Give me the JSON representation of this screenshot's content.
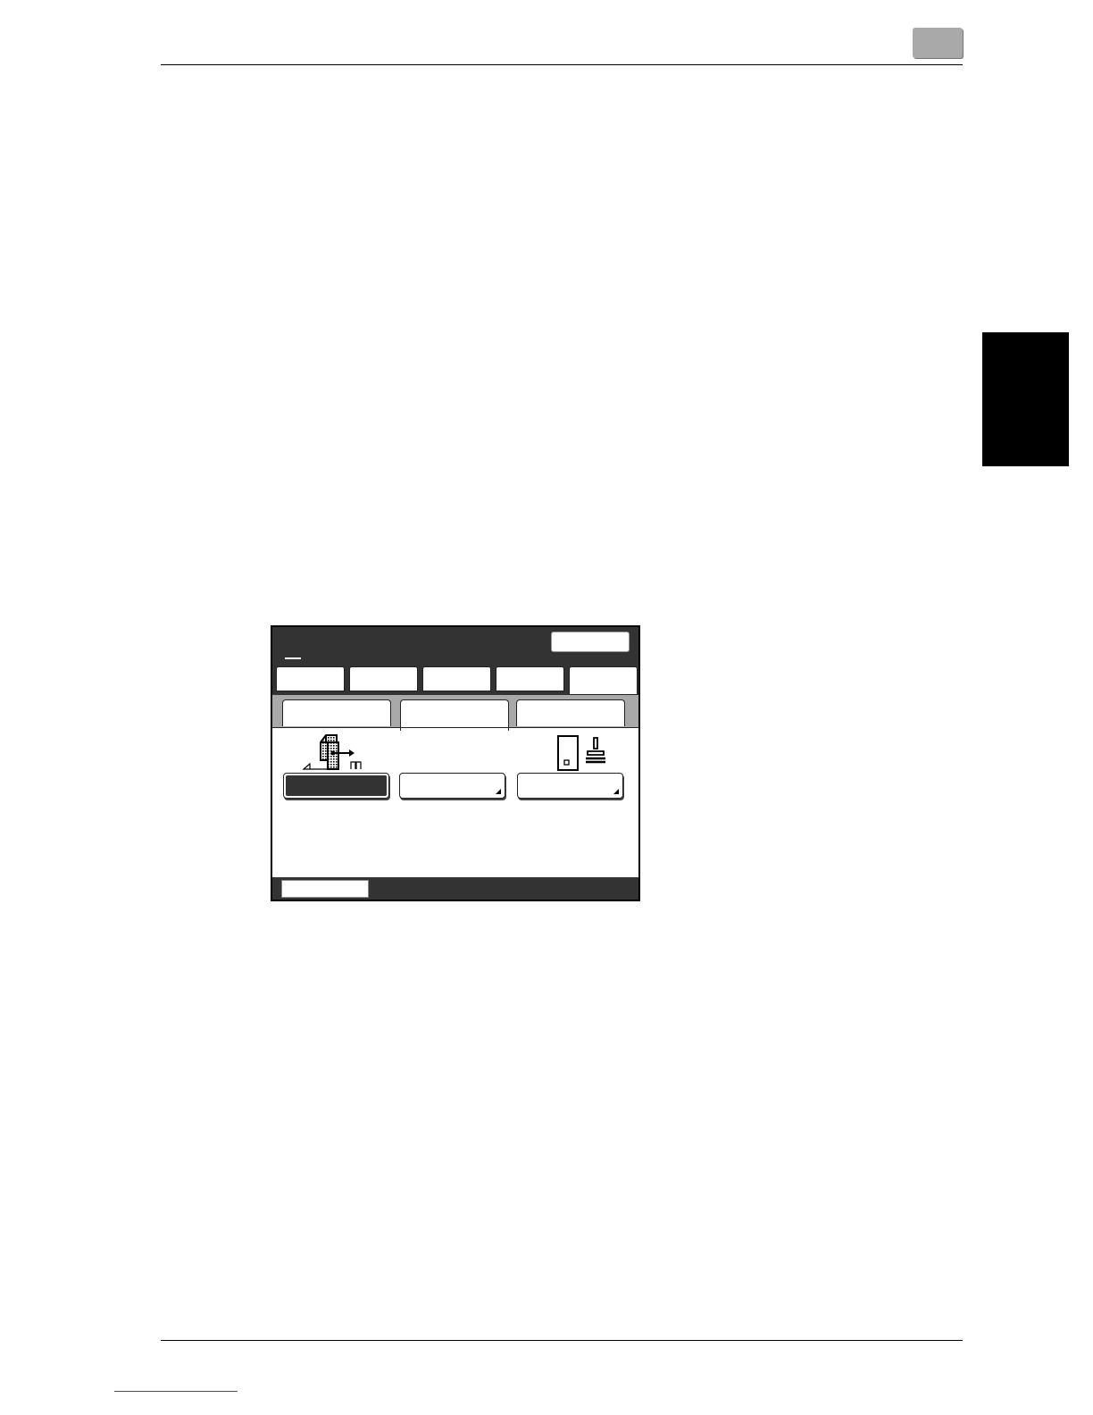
{
  "page": {
    "chapter_tab_color": "#000000",
    "page_number_box_color": "#a9a9a9"
  },
  "screen": {
    "title_bar_color": "#333333",
    "subtab_strip_color": "#a9a9a9",
    "main_tabs": [
      {
        "icon": "blank-tab"
      },
      {
        "icon": "blank-tab"
      },
      {
        "icon": "blank-tab"
      },
      {
        "icon": "blank-tab"
      },
      {
        "icon": "blank-tab",
        "active": true
      }
    ],
    "sub_tabs": [
      {
        "icon": "blank-tab"
      },
      {
        "icon": "blank-tab",
        "active": true
      },
      {
        "icon": "blank-tab"
      }
    ],
    "icons": [
      "page-layout-arrow-icon",
      "page-stamp-icon"
    ],
    "function_buttons": [
      {
        "selected": true
      },
      {
        "selected": false,
        "has_submenu": true
      },
      {
        "selected": false,
        "has_submenu": true
      }
    ]
  }
}
